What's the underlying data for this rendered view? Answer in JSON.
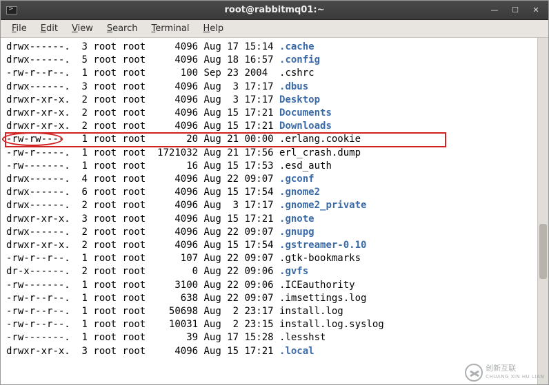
{
  "window": {
    "title": "root@rabbitmq01:~"
  },
  "menu": {
    "file": "File",
    "edit": "Edit",
    "view": "View",
    "search": "Search",
    "terminal": "Terminal",
    "help": "Help"
  },
  "listing": [
    {
      "perms": "drwx------.",
      "links": "3",
      "owner": "root",
      "group": "root",
      "size": "4096",
      "mon": "Aug",
      "day": "17",
      "time": "15:14",
      "name": ".cache",
      "type": "dir"
    },
    {
      "perms": "drwx------.",
      "links": "5",
      "owner": "root",
      "group": "root",
      "size": "4096",
      "mon": "Aug",
      "day": "18",
      "time": "16:57",
      "name": ".config",
      "type": "dir"
    },
    {
      "perms": "-rw-r--r--.",
      "links": "1",
      "owner": "root",
      "group": "root",
      "size": "100",
      "mon": "Sep",
      "day": "23",
      "time": "2004",
      "name": ".cshrc",
      "type": "reg"
    },
    {
      "perms": "drwx------.",
      "links": "3",
      "owner": "root",
      "group": "root",
      "size": "4096",
      "mon": "Aug",
      "day": "3",
      "time": "17:17",
      "name": ".dbus",
      "type": "dir"
    },
    {
      "perms": "drwxr-xr-x.",
      "links": "2",
      "owner": "root",
      "group": "root",
      "size": "4096",
      "mon": "Aug",
      "day": "3",
      "time": "17:17",
      "name": "Desktop",
      "type": "dir"
    },
    {
      "perms": "drwxr-xr-x.",
      "links": "2",
      "owner": "root",
      "group": "root",
      "size": "4096",
      "mon": "Aug",
      "day": "15",
      "time": "17:21",
      "name": "Documents",
      "type": "dir"
    },
    {
      "perms": "drwxr-xr-x.",
      "links": "2",
      "owner": "root",
      "group": "root",
      "size": "4096",
      "mon": "Aug",
      "day": "15",
      "time": "17:21",
      "name": "Downloads",
      "type": "dir"
    },
    {
      "perms": "-rw-rw----",
      "links": "1",
      "owner": "root",
      "group": "root",
      "size": "20",
      "mon": "Aug",
      "day": "21",
      "time": "00:00",
      "name": ".erlang.cookie",
      "type": "reg"
    },
    {
      "perms": "-rw-r-----.",
      "links": "1",
      "owner": "root",
      "group": "root",
      "size": "1721032",
      "mon": "Aug",
      "day": "21",
      "time": "17:56",
      "name": "erl_crash.dump",
      "type": "reg"
    },
    {
      "perms": "-rw-------.",
      "links": "1",
      "owner": "root",
      "group": "root",
      "size": "16",
      "mon": "Aug",
      "day": "15",
      "time": "17:53",
      "name": ".esd_auth",
      "type": "reg"
    },
    {
      "perms": "drwx------.",
      "links": "4",
      "owner": "root",
      "group": "root",
      "size": "4096",
      "mon": "Aug",
      "day": "22",
      "time": "09:07",
      "name": ".gconf",
      "type": "dir"
    },
    {
      "perms": "drwx------.",
      "links": "6",
      "owner": "root",
      "group": "root",
      "size": "4096",
      "mon": "Aug",
      "day": "15",
      "time": "17:54",
      "name": ".gnome2",
      "type": "dir"
    },
    {
      "perms": "drwx------.",
      "links": "2",
      "owner": "root",
      "group": "root",
      "size": "4096",
      "mon": "Aug",
      "day": "3",
      "time": "17:17",
      "name": ".gnome2_private",
      "type": "dir"
    },
    {
      "perms": "drwxr-xr-x.",
      "links": "3",
      "owner": "root",
      "group": "root",
      "size": "4096",
      "mon": "Aug",
      "day": "15",
      "time": "17:21",
      "name": ".gnote",
      "type": "dir"
    },
    {
      "perms": "drwx------.",
      "links": "2",
      "owner": "root",
      "group": "root",
      "size": "4096",
      "mon": "Aug",
      "day": "22",
      "time": "09:07",
      "name": ".gnupg",
      "type": "dir"
    },
    {
      "perms": "drwxr-xr-x.",
      "links": "2",
      "owner": "root",
      "group": "root",
      "size": "4096",
      "mon": "Aug",
      "day": "15",
      "time": "17:54",
      "name": ".gstreamer-0.10",
      "type": "dir"
    },
    {
      "perms": "-rw-r--r--.",
      "links": "1",
      "owner": "root",
      "group": "root",
      "size": "107",
      "mon": "Aug",
      "day": "22",
      "time": "09:07",
      "name": ".gtk-bookmarks",
      "type": "reg"
    },
    {
      "perms": "dr-x------.",
      "links": "2",
      "owner": "root",
      "group": "root",
      "size": "0",
      "mon": "Aug",
      "day": "22",
      "time": "09:06",
      "name": ".gvfs",
      "type": "dir"
    },
    {
      "perms": "-rw-------.",
      "links": "1",
      "owner": "root",
      "group": "root",
      "size": "3100",
      "mon": "Aug",
      "day": "22",
      "time": "09:06",
      "name": ".ICEauthority",
      "type": "reg"
    },
    {
      "perms": "-rw-r--r--.",
      "links": "1",
      "owner": "root",
      "group": "root",
      "size": "638",
      "mon": "Aug",
      "day": "22",
      "time": "09:07",
      "name": ".imsettings.log",
      "type": "reg"
    },
    {
      "perms": "-rw-r--r--.",
      "links": "1",
      "owner": "root",
      "group": "root",
      "size": "50698",
      "mon": "Aug",
      "day": "2",
      "time": "23:17",
      "name": "install.log",
      "type": "reg"
    },
    {
      "perms": "-rw-r--r--.",
      "links": "1",
      "owner": "root",
      "group": "root",
      "size": "10031",
      "mon": "Aug",
      "day": "2",
      "time": "23:15",
      "name": "install.log.syslog",
      "type": "reg"
    },
    {
      "perms": "-rw-------.",
      "links": "1",
      "owner": "root",
      "group": "root",
      "size": "39",
      "mon": "Aug",
      "day": "17",
      "time": "15:28",
      "name": ".lesshst",
      "type": "reg"
    },
    {
      "perms": "drwxr-xr-x.",
      "links": "3",
      "owner": "root",
      "group": "root",
      "size": "4096",
      "mon": "Aug",
      "day": "15",
      "time": "17:21",
      "name": ".local",
      "type": "dir"
    }
  ],
  "highlight_row_index": 7,
  "watermark": {
    "line1": "创新互联",
    "line2": "CHUANG XIN HU LIAN"
  }
}
